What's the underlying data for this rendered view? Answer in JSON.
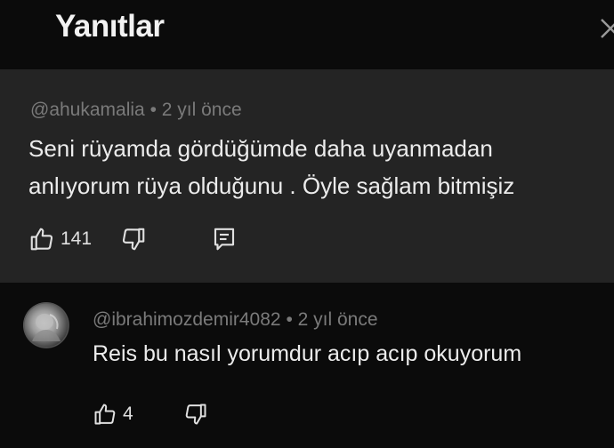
{
  "header": {
    "title": "Yanıtlar"
  },
  "parent_comment": {
    "author": "@ahukamalia",
    "separator": "•",
    "time": "2 yıl önce",
    "text": "Seni rüyamda gördüğümde daha uyanmadan anlıyorum rüya olduğunu . Öyle sağlam bitmişiz",
    "like_count": "141"
  },
  "reply": {
    "author": "@ibrahimozdemir4082",
    "separator": "•",
    "time": "2 yıl önce",
    "text": "Reis bu nasıl yorumdur acıp acıp okuyorum",
    "like_count": "4"
  },
  "icons": {
    "like": "thumbs-up-icon",
    "dislike": "thumbs-down-icon",
    "reply": "comment-icon",
    "close": "close-icon"
  }
}
